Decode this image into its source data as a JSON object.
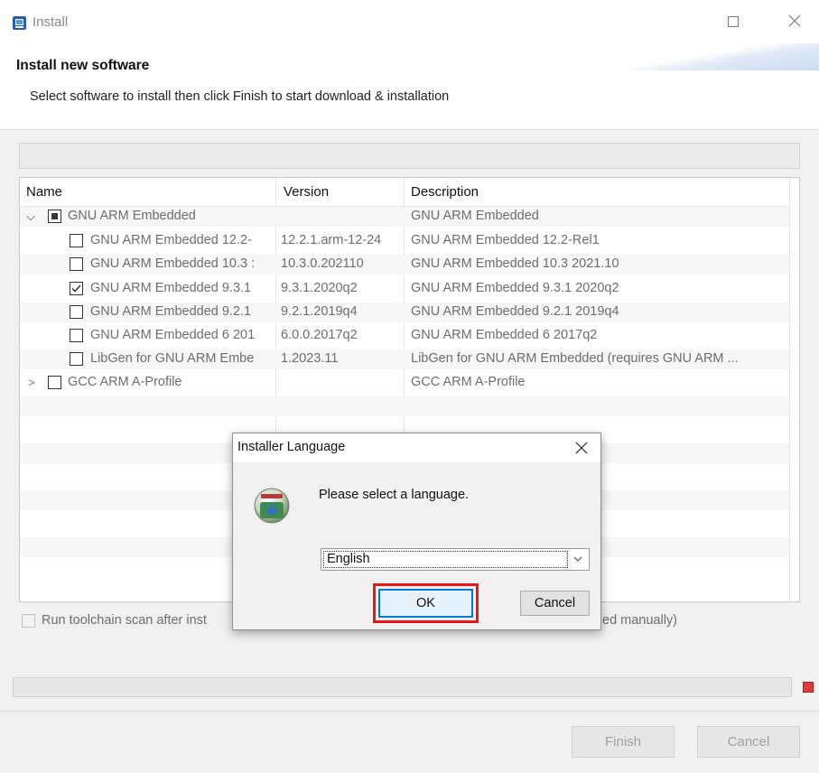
{
  "window": {
    "title": "Install",
    "icon": "eclipse-installer-icon"
  },
  "header": {
    "title": "Install new software",
    "description": "Select software to install then click Finish to start download & installation"
  },
  "table": {
    "columns": [
      "Name",
      "Version",
      "Description"
    ],
    "rows": [
      {
        "name": "GNU ARM Embedded",
        "version": "",
        "description": "GNU ARM Embedded",
        "level": 0,
        "expanded": true,
        "check": "partial"
      },
      {
        "name": "GNU ARM Embedded 12.2-",
        "version": "12.2.1.arm-12-24",
        "description": "GNU ARM Embedded 12.2-Rel1",
        "level": 1,
        "check": "unchecked"
      },
      {
        "name": "GNU ARM Embedded 10.3 :",
        "version": "10.3.0.202110",
        "description": "GNU ARM Embedded 10.3 2021.10",
        "level": 1,
        "check": "unchecked"
      },
      {
        "name": "GNU ARM Embedded 9.3.1",
        "version": "9.3.1.2020q2",
        "description": "GNU ARM Embedded 9.3.1 2020q2",
        "level": 1,
        "check": "checked"
      },
      {
        "name": "GNU ARM Embedded 9.2.1",
        "version": "9.2.1.2019q4",
        "description": "GNU ARM Embedded 9.2.1 2019q4",
        "level": 1,
        "check": "unchecked"
      },
      {
        "name": "GNU ARM Embedded 6 201",
        "version": "6.0.0.2017q2",
        "description": "GNU ARM Embedded 6 2017q2",
        "level": 1,
        "check": "unchecked"
      },
      {
        "name": "LibGen for GNU ARM Embe",
        "version": "1.2023.11",
        "description": "LibGen for GNU ARM Embedded (requires GNU ARM ...",
        "level": 1,
        "check": "unchecked"
      },
      {
        "name": "GCC ARM A-Profile",
        "version": "",
        "description": "GCC ARM A-Profile",
        "level": 0,
        "expanded": false,
        "check": "unchecked"
      }
    ]
  },
  "options": {
    "run_scan_left": "Run toolchain scan after inst",
    "run_scan_right": "ed manually)"
  },
  "buttons": {
    "finish": "Finish",
    "cancel": "Cancel"
  },
  "dialog": {
    "title": "Installer Language",
    "message": "Please select a language.",
    "selected_language": "English",
    "ok": "OK",
    "cancel": "Cancel",
    "highlight_color": "#e8171a"
  }
}
